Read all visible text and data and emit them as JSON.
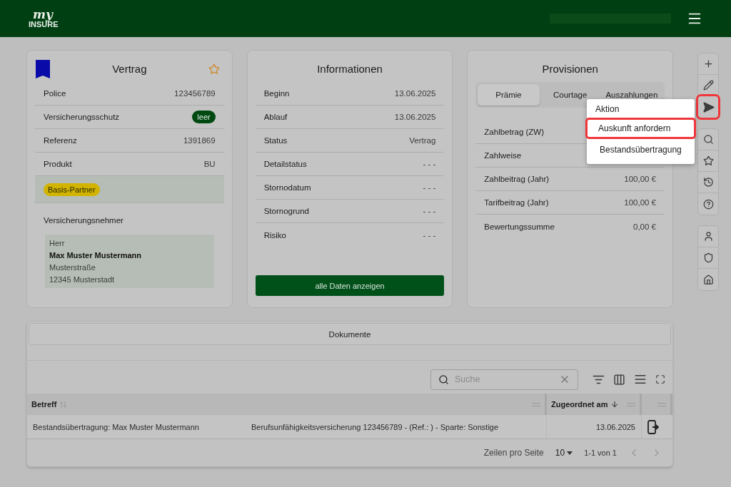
{
  "header": {
    "logo_top": "my",
    "logo_bottom": "INSURE"
  },
  "contract": {
    "title": "Vertrag",
    "favorite": false,
    "rows": [
      {
        "label": "Police",
        "value": "123456789",
        "kind": "text"
      },
      {
        "label": "Versicherungsschutz",
        "value": "leer",
        "kind": "pill"
      },
      {
        "label": "Referenz",
        "value": "1391869",
        "kind": "text"
      },
      {
        "label": "Produkt",
        "value": "BU",
        "kind": "text"
      }
    ],
    "tag": "Basis-Partner",
    "holder_heading": "Versicherungsnehmer",
    "address": [
      {
        "text": "Herr",
        "bold": false
      },
      {
        "text": "Max Muster Mustermann",
        "bold": true
      },
      {
        "text": "Musterstraße",
        "bold": false
      },
      {
        "text": "12345 Musterstadt",
        "bold": false
      }
    ]
  },
  "information": {
    "title": "Informationen",
    "rows": [
      {
        "label": "Beginn",
        "value": "13.06.2025"
      },
      {
        "label": "Ablauf",
        "value": "13.06.2025"
      },
      {
        "label": "Status",
        "value": "Vertrag"
      },
      {
        "label": "Detailstatus",
        "value": "- - -"
      },
      {
        "label": "Stornodatum",
        "value": "- - -"
      },
      {
        "label": "Stornogrund",
        "value": "- - -"
      },
      {
        "label": "Risiko",
        "value": "- - -"
      }
    ],
    "button": "alle Daten anzeigen"
  },
  "commissions": {
    "title": "Provisionen",
    "tabs": [
      {
        "label": "Prämie",
        "selected": true
      },
      {
        "label": "Courtage",
        "selected": false
      },
      {
        "label": "Auszahlungen",
        "selected": false
      }
    ],
    "rows": [
      {
        "label": "Zahlbetrag (ZW)"
      },
      {
        "label": "Zahlweise"
      },
      {
        "label": "Zahlbeitrag (Jahr)",
        "value": "100,00 €"
      },
      {
        "label": "Tarifbeitrag (Jahr)",
        "value": "100,00 €"
      },
      {
        "label": "Bewertungssumme",
        "value": "0,00 €"
      }
    ]
  },
  "toolbar": [
    [
      {
        "kind": "add",
        "highlighted": false
      },
      {
        "kind": "edit",
        "highlighted": false
      },
      {
        "kind": "send",
        "highlighted": true
      }
    ],
    [
      {
        "kind": "search",
        "highlighted": false
      },
      {
        "kind": "favorite",
        "highlighted": false
      },
      {
        "kind": "history",
        "highlighted": false
      },
      {
        "kind": "help",
        "highlighted": false
      }
    ],
    [
      {
        "kind": "person",
        "highlighted": false
      },
      {
        "kind": "shield",
        "highlighted": false
      },
      {
        "kind": "home",
        "highlighted": false
      }
    ]
  ],
  "menu": {
    "title": "Aktion",
    "items": [
      {
        "label": "Auskunft anfordern",
        "highlighted": true
      },
      {
        "label": "Bestandsübertragung",
        "highlighted": false
      }
    ]
  },
  "documents": {
    "title": "Dokumente",
    "search": {
      "placeholder": "Suche"
    },
    "columns": [
      {
        "label": "Betreff",
        "sorted": false
      },
      {
        "label": "Zugeordnet am",
        "sorted": true
      }
    ],
    "rows": [
      {
        "cells": [
          "Bestandsübertragung: Max Muster Mustermann",
          "Berufsunfähigkeitsversicherung 123456789 - (Ref.: ) - Sparte: Sonstige",
          "13.06.2025"
        ]
      }
    ],
    "footer": {
      "rows_label": "Zeilen pro Seite",
      "rows_value": "10",
      "range": "1-1 von 1"
    }
  }
}
